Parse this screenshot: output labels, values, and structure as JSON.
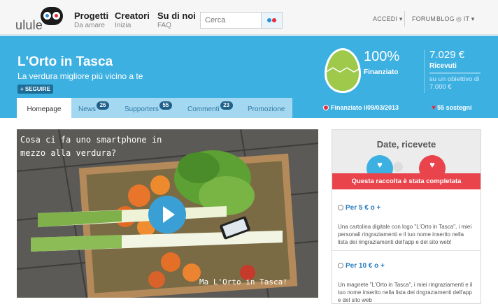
{
  "nav": {
    "logo_text": "ulule",
    "links": [
      {
        "main": "Progetti",
        "sub": "Da amare"
      },
      {
        "main": "Creatori",
        "sub": "Inizia"
      },
      {
        "main": "Su di noi",
        "sub": "FAQ"
      }
    ],
    "search_placeholder": "Cerca",
    "accedi": "ACCEDI ▾",
    "forum": "FORUM",
    "blog": "BLOG",
    "lang": "◎ IT ▾"
  },
  "project": {
    "title": "L'Orto in Tasca",
    "tagline": "La verdura migliore più vicino a te",
    "follow": "+ SEGUIRE"
  },
  "tabs": [
    {
      "label": "Homepage",
      "badge": ""
    },
    {
      "label": "News",
      "badge": "26"
    },
    {
      "label": "Supporters",
      "badge": "55"
    },
    {
      "label": "Commenti",
      "badge": "23"
    },
    {
      "label": "Promozione",
      "badge": ""
    }
  ],
  "stats": {
    "percent": "100%",
    "percent_label": "Finanziato",
    "amount": "7.029 €",
    "amount_label": "Ricevuti",
    "goal": "su un obiettivo di 7.000 €",
    "funded_date": "Finanziato il09/03/2013",
    "supporters": "55 sostegni"
  },
  "video": {
    "caption_top": "Cosa ci fa uno smartphone in mezzo alla verdura?",
    "caption_bottom": "Ma L'Orto in Tasca!"
  },
  "rewards": {
    "title": "Date, ricevete",
    "banner": "Questa raccolta è stata completata",
    "items": [
      {
        "price": "Per 5 € o +",
        "desc": "Una cartolina digitale con logo \"L'Orto in Tasca\", i miei personali ringraziamenti e il tuo nome inserito nella lista dei ringraziamenti dell'app e del sito web!"
      },
      {
        "price": "Per 10 € o +",
        "desc": "Un magnete \"L'Orto in Tasca\", i miei ringraziamenti e il tuo nome inserito nella lista dei ringraziamenti dell'app e del sito web"
      }
    ]
  },
  "colors": {
    "brand_blue": "#3db0e2",
    "accent_red": "#e9434b",
    "egg_green": "#9ec94a"
  }
}
